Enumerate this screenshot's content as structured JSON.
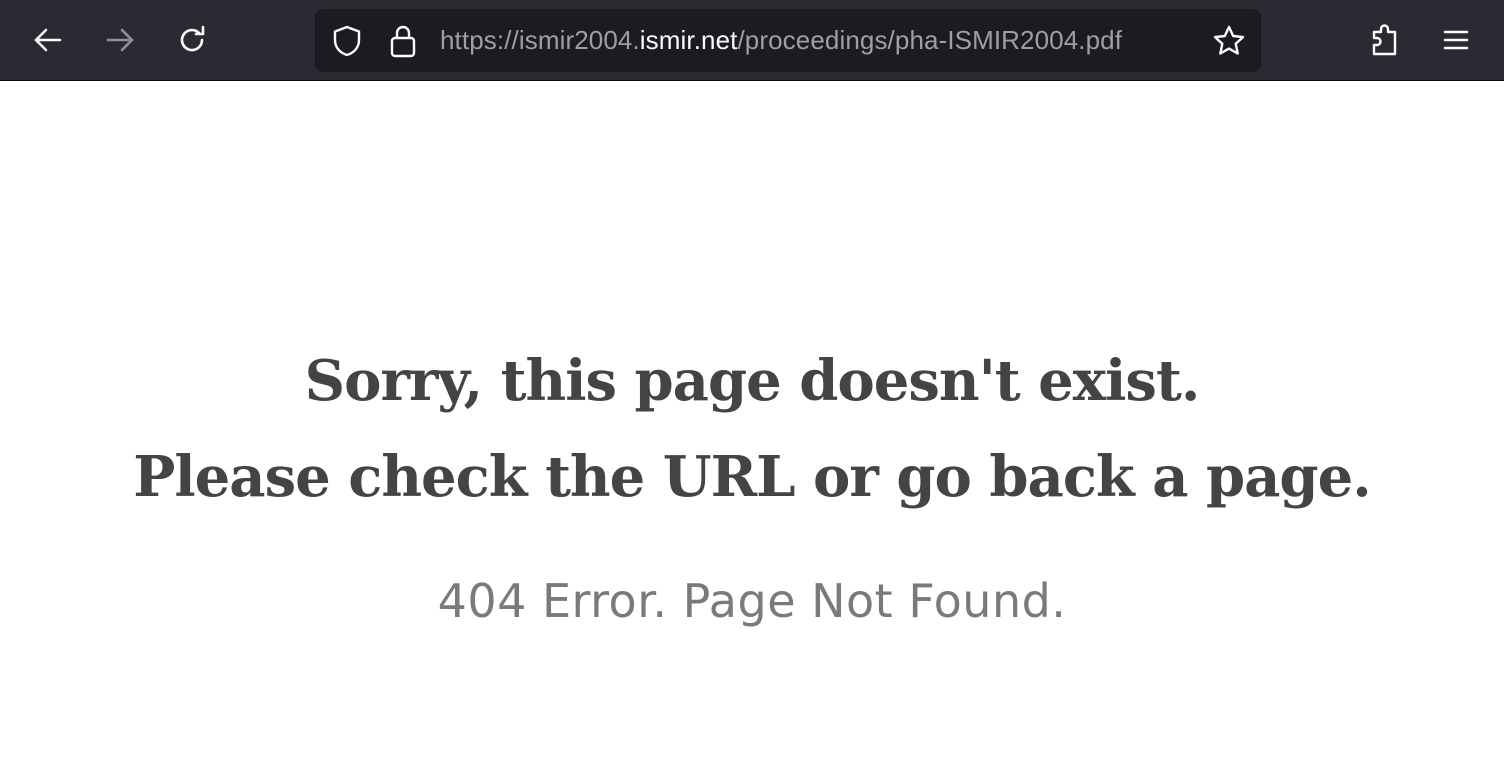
{
  "browser": {
    "url": {
      "prefix": "https://ismir2004.",
      "host": "ismir.net",
      "path": "/proceedings/pha-ISMIR2004.pdf"
    },
    "icons": {
      "back": "arrow-left-icon",
      "forward": "arrow-right-icon",
      "reload": "reload-icon",
      "tracking_protection": "shield-icon",
      "secure": "lock-icon",
      "bookmark": "star-icon",
      "extensions": "puzzle-icon",
      "menu": "hamburger-menu-icon"
    },
    "colors": {
      "toolbar_bg": "#2b2a33",
      "urlbar_bg": "#1c1b22",
      "icon": "#fbfbfe",
      "icon_disabled": "#8f8f9d"
    }
  },
  "page": {
    "heading_line_1": "Sorry, this page doesn't exist.",
    "heading_line_2": "Please check the URL or go back a page.",
    "subheading": "404 Error. Page Not Found.",
    "colors": {
      "heading": "#444444",
      "subheading": "#7a7a7a",
      "background": "#ffffff"
    }
  }
}
